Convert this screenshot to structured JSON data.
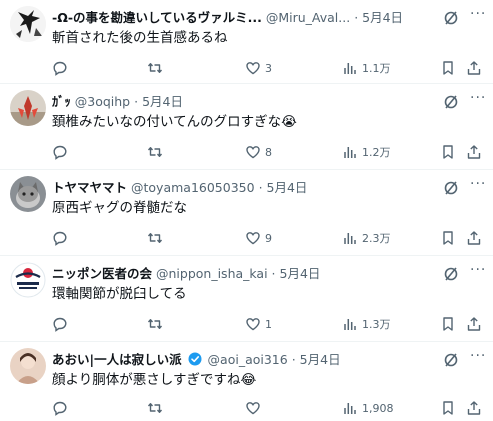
{
  "tweets": [
    {
      "name": "-Ω-の事を勘違いしているヴァルミ...",
      "handle": "@Miru_Aval...",
      "dot": "·",
      "date": "5月4日",
      "text": "斬首された後の生首感あるね",
      "verified": false,
      "counts": {
        "reply": "",
        "repost": "",
        "like": "3",
        "views": "1.1万"
      },
      "avatar_icon": "cross-sketch-avatar"
    },
    {
      "name": "ｶﾞｯ",
      "handle": "@3oqihp",
      "dot": "·",
      "date": "5月4日",
      "text": "頚椎みたいなの付いてんのグロすぎな😭",
      "verified": false,
      "counts": {
        "reply": "",
        "repost": "",
        "like": "8",
        "views": "1.2万"
      },
      "avatar_icon": "red-plant-avatar"
    },
    {
      "name": "トヤマヤマト",
      "handle": "@toyama16050350",
      "dot": "·",
      "date": "5月4日",
      "text": "原西ギャグの脊髄だな",
      "verified": false,
      "counts": {
        "reply": "",
        "repost": "",
        "like": "9",
        "views": "2.3万"
      },
      "avatar_icon": "cat-avatar"
    },
    {
      "name": "ニッポン医者の会",
      "handle": "@nippon_isha_kai",
      "dot": "·",
      "date": "5月4日",
      "text": "環軸関節が脱臼してる",
      "verified": false,
      "counts": {
        "reply": "",
        "repost": "",
        "like": "1",
        "views": "1.3万"
      },
      "avatar_icon": "nippon-logo-avatar"
    },
    {
      "name": "あおい|一人は寂しい派",
      "handle": "@aoi_aoi316",
      "dot": "·",
      "date": "5月4日",
      "text": "顔より胴体が悪さしすぎですね😂",
      "verified": true,
      "counts": {
        "reply": "",
        "repost": "",
        "like": "",
        "views": "1,908"
      },
      "avatar_icon": "person-avatar"
    }
  ],
  "colors": {
    "text": "#0f1419",
    "muted": "#536471",
    "verified": "#1d9bf0",
    "divider": "#eff3f4"
  }
}
